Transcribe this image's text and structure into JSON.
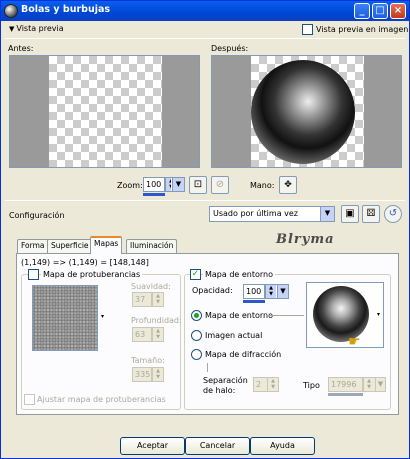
{
  "window": {
    "title": "Bolas y burbujas"
  },
  "titlebar_buttons": {
    "minimize": "_",
    "maximize": "□",
    "close": "×"
  },
  "preview": {
    "toggle_label": "Vista previa",
    "in_image_label": "Vista previa en imagen",
    "before_label": "Antes:",
    "after_label": "Después:",
    "zoom_label": "Zoom:",
    "zoom_value": "100",
    "hand_label": "Mano:"
  },
  "config": {
    "label": "Configuración",
    "preset_value": "Usado por última vez"
  },
  "watermark": "Blryma",
  "tabs": [
    {
      "label": "Forma"
    },
    {
      "label": "Superficie"
    },
    {
      "label": "Mapas"
    },
    {
      "label": "Iluminación"
    }
  ],
  "maps": {
    "coords": "(1,149) => (1,149) = [148,148]",
    "bump_label": "Mapa de protuberancias",
    "smoothness_label": "Suavidad:",
    "smoothness_value": "37",
    "depth_label": "Profundidad:",
    "depth_value": "63",
    "size_label": "Tamaño:",
    "size_value": "335",
    "fit_bump_label": "Ajustar mapa de protuberancias",
    "env_label": "Mapa de entorno",
    "opacity_label": "Opacidad:",
    "opacity_value": "100",
    "radio_env": "Mapa de entorno",
    "radio_image": "Imagen actual",
    "radio_diffraction": "Mapa de difracción",
    "halo_label_1": "Separación",
    "halo_label_2": "de halo:",
    "halo_value": "2",
    "type_label": "Tipo",
    "type_value": "17996"
  },
  "buttons": {
    "accept": "Aceptar",
    "cancel": "Cancelar",
    "help": "Ayuda"
  }
}
